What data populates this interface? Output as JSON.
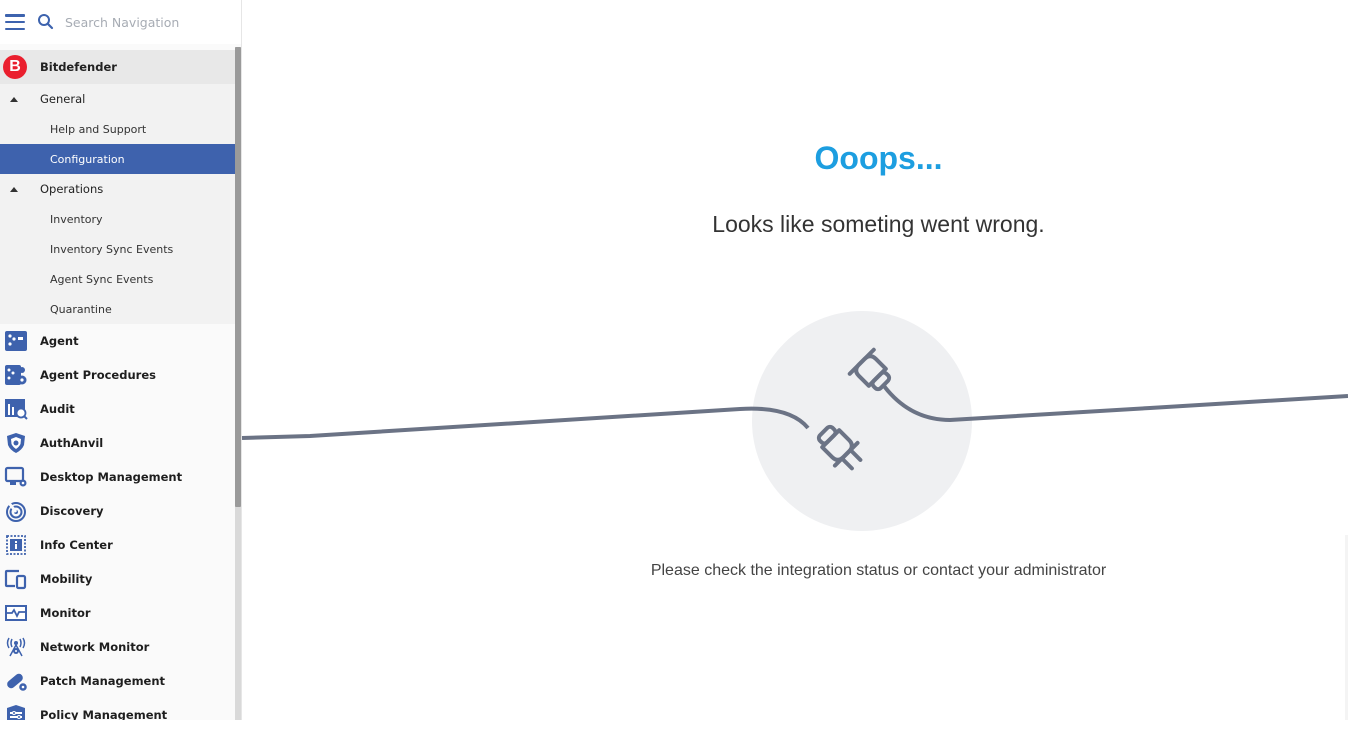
{
  "topbar": {
    "menu_icon": "hamburger-icon",
    "search_icon": "search-icon",
    "search_placeholder": "Search Navigation",
    "search_value": ""
  },
  "sidebar": {
    "brand": {
      "label": "Bitdefender",
      "logo_letter": "B",
      "logo_color": "#ea1f2e"
    },
    "groups": [
      {
        "label": "General",
        "expanded": true,
        "items": [
          {
            "label": "Help and Support",
            "active": false
          },
          {
            "label": "Configuration",
            "active": true
          }
        ]
      },
      {
        "label": "Operations",
        "expanded": true,
        "items": [
          {
            "label": "Inventory",
            "active": false
          },
          {
            "label": "Inventory Sync Events",
            "active": false
          },
          {
            "label": "Agent Sync Events",
            "active": false
          },
          {
            "label": "Quarantine",
            "active": false
          }
        ]
      }
    ],
    "modules": [
      {
        "label": "Agent",
        "icon": "agent-icon"
      },
      {
        "label": "Agent Procedures",
        "icon": "agent-procedures-icon"
      },
      {
        "label": "Audit",
        "icon": "audit-icon"
      },
      {
        "label": "AuthAnvil",
        "icon": "shield-icon"
      },
      {
        "label": "Desktop Management",
        "icon": "desktop-gear-icon"
      },
      {
        "label": "Discovery",
        "icon": "radar-icon"
      },
      {
        "label": "Info Center",
        "icon": "info-icon"
      },
      {
        "label": "Mobility",
        "icon": "mobile-devices-icon"
      },
      {
        "label": "Monitor",
        "icon": "monitor-pulse-icon"
      },
      {
        "label": "Network Monitor",
        "icon": "network-antenna-icon"
      },
      {
        "label": "Patch Management",
        "icon": "patch-gear-icon"
      },
      {
        "label": "Policy Management",
        "icon": "policy-icon"
      }
    ]
  },
  "main": {
    "title": "Ooops...",
    "subtitle": "Looks like someting went wrong.",
    "hint": "Please check the integration status or contact your administrator",
    "illustration": "unplugged-cable-icon"
  },
  "colors": {
    "accent": "#3e62ad",
    "title": "#1d9ee0",
    "cable": "#6b7385",
    "circle": "#eff0f2"
  }
}
